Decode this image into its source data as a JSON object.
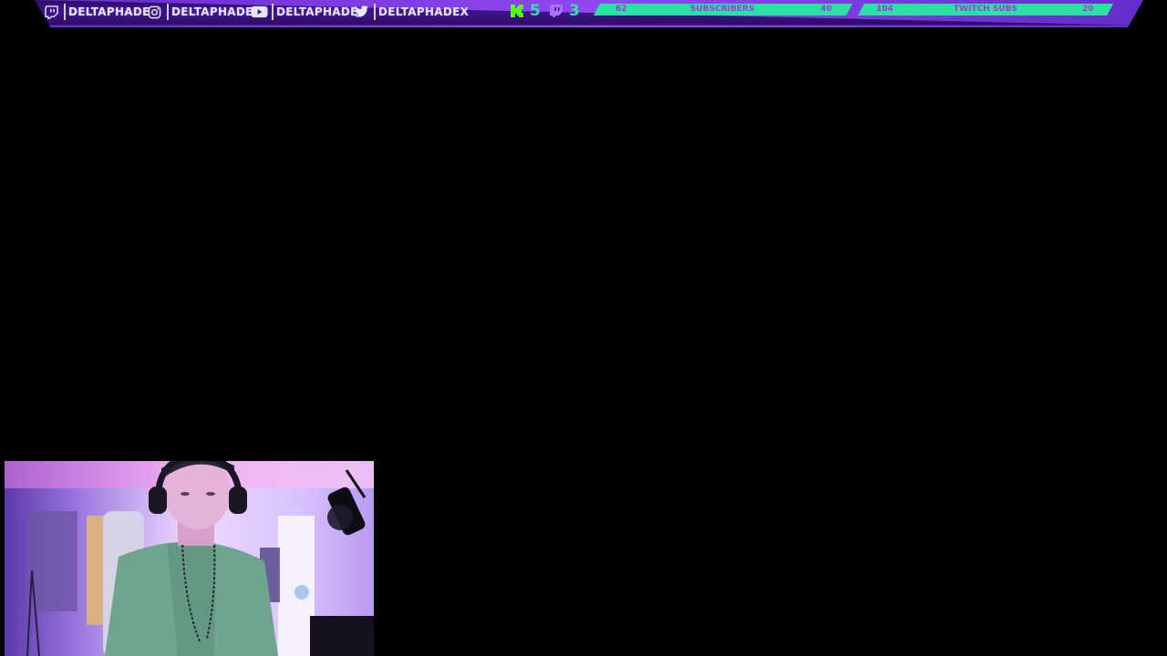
{
  "socials": [
    {
      "icon": "twitch-icon",
      "handle": "DELTAPHADE"
    },
    {
      "icon": "instagram-icon",
      "handle": "DELTAPHADE"
    },
    {
      "icon": "youtube-icon",
      "handle": "DELTAPHADE"
    },
    {
      "icon": "twitter-icon",
      "handle": "DELTAPHADEX"
    }
  ],
  "counters": {
    "kick": {
      "icon": "kick-icon",
      "value": "5"
    },
    "twitch": {
      "icon": "twitch-icon",
      "value": "3"
    }
  },
  "goals": [
    {
      "current": "62",
      "label": "SUBSCRIBERS",
      "target": "40"
    },
    {
      "current": "104",
      "label": "TWITCH SUBS",
      "target": "20"
    }
  ],
  "colors": {
    "bar_bg": "#2d0f63",
    "accent_green": "#27e39f",
    "goal_text": "#a238e0",
    "handle_text": "#e4e8ff"
  }
}
